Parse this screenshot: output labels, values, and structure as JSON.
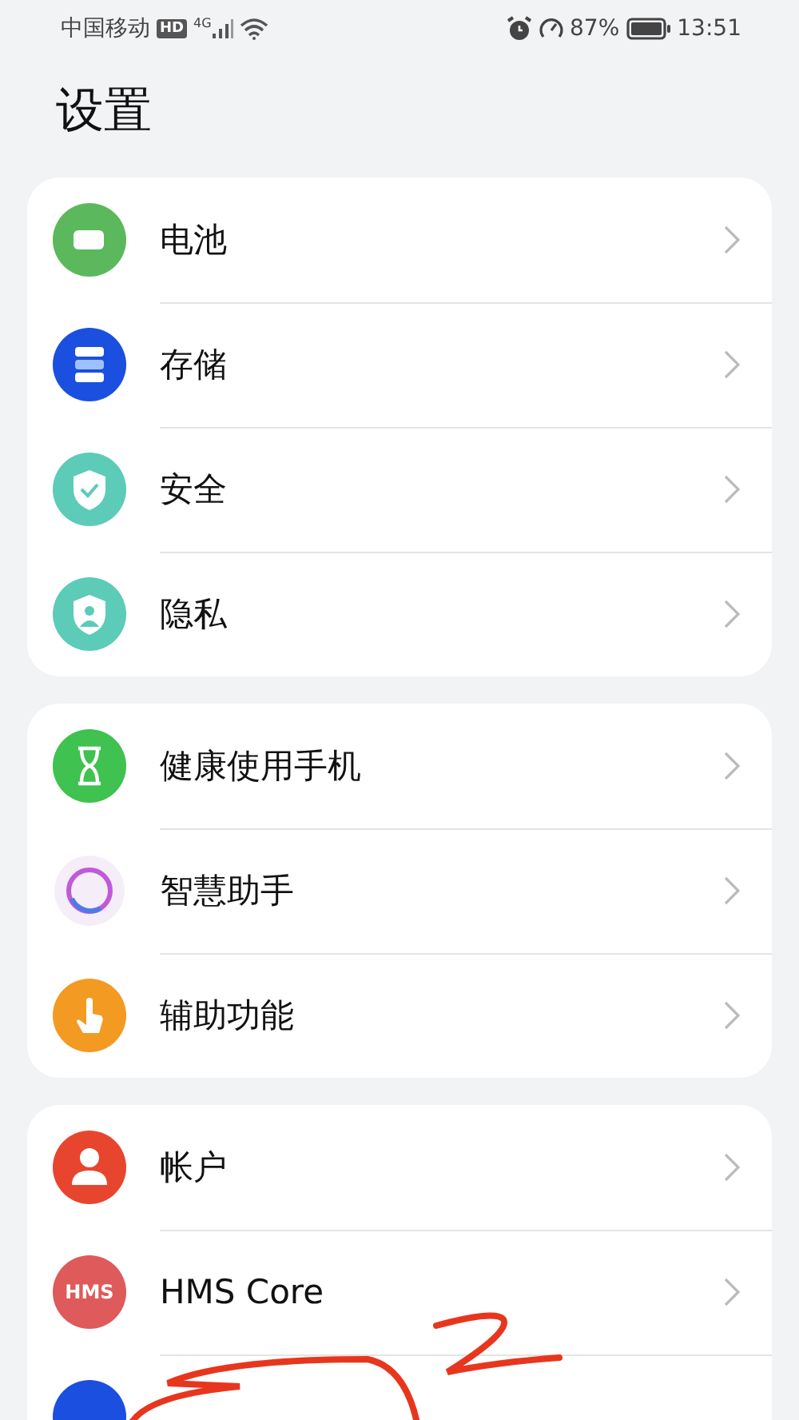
{
  "status_bar": {
    "carrier": "中国移动",
    "hd_badge": "HD",
    "network_type": "4G",
    "battery": "87%",
    "time": "13:51"
  },
  "title": "设置",
  "groups": [
    {
      "items": [
        {
          "kind": "battery",
          "label": "电池"
        },
        {
          "kind": "storage",
          "label": "存储"
        },
        {
          "kind": "security",
          "label": "安全"
        },
        {
          "kind": "privacy",
          "label": "隐私"
        }
      ]
    },
    {
      "items": [
        {
          "kind": "hourglass",
          "label": "健康使用手机"
        },
        {
          "kind": "assistant",
          "label": "智慧助手"
        },
        {
          "kind": "accessibility",
          "label": "辅助功能"
        }
      ]
    },
    {
      "items": [
        {
          "kind": "account",
          "label": "帐户"
        },
        {
          "kind": "hms",
          "icon_text": "HMS",
          "label": "HMS Core"
        },
        {
          "kind": "partial"
        }
      ]
    }
  ]
}
